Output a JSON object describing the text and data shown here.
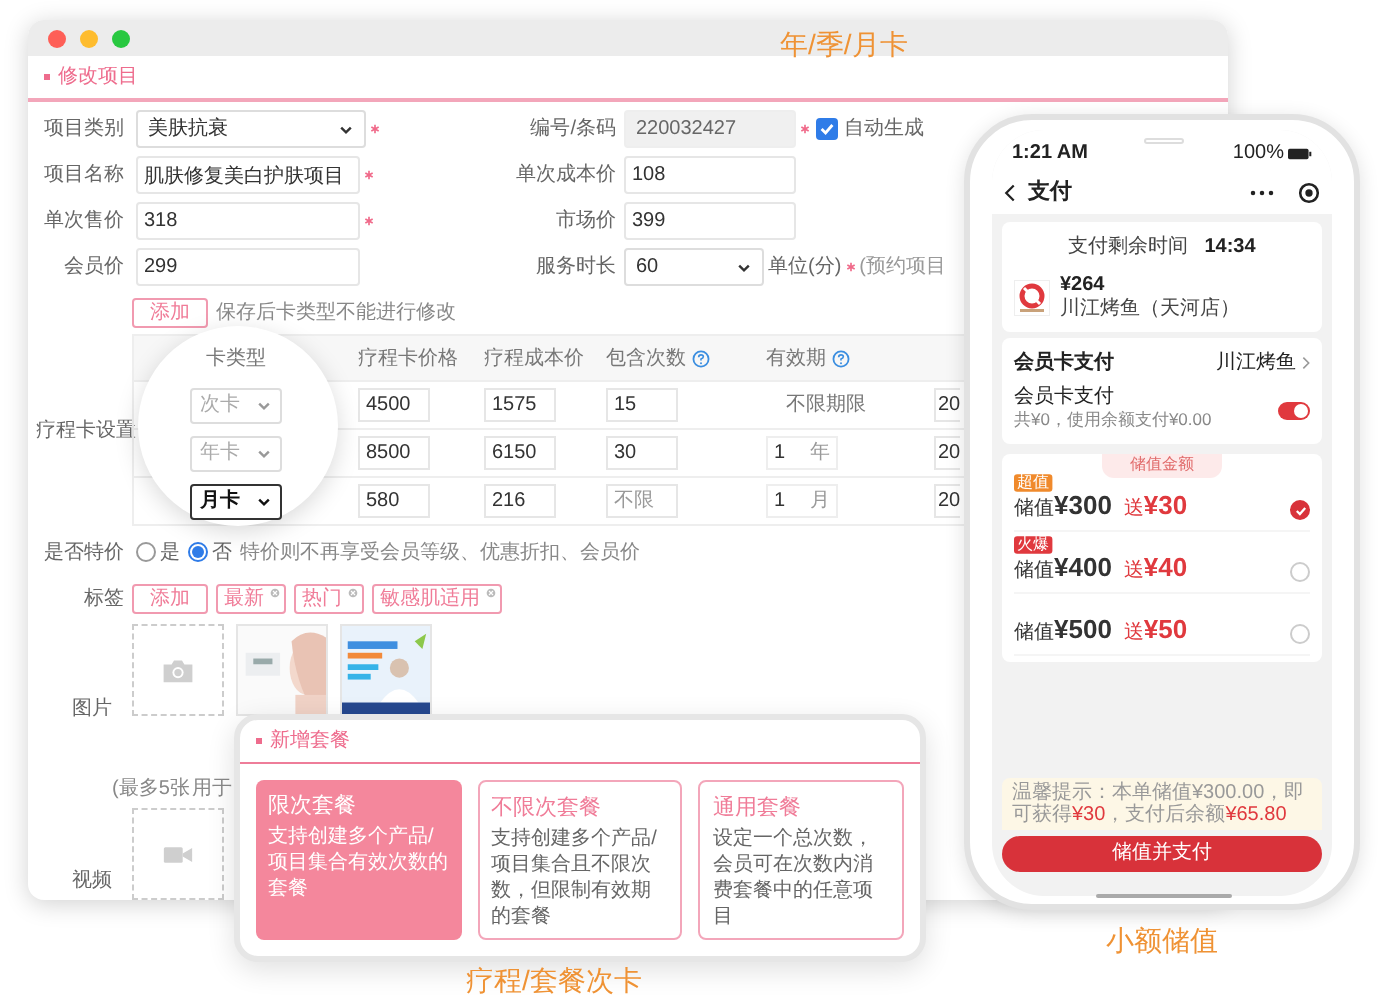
{
  "captions": [
    {
      "text": "年/季/月卡"
    },
    {
      "text": "疗程/套餐次卡"
    },
    {
      "text": "小额储值"
    }
  ],
  "editor": {
    "title": "修改项目",
    "rows": [
      {
        "left": {
          "label": "项目类别",
          "kind": "select",
          "value": "美肤抗衰",
          "required": true
        },
        "right": {
          "label": "编号/条码",
          "kind": "readonly",
          "value": "220032427",
          "required": true,
          "checkbox": {
            "label": "自动生成",
            "checked": true
          }
        }
      },
      {
        "left": {
          "label": "项目名称",
          "kind": "input",
          "value": "肌肤修复美白护肤项目",
          "required": true
        },
        "right": {
          "label": "单次成本价",
          "kind": "input",
          "value": "108",
          "required": false
        }
      },
      {
        "left": {
          "label": "单次售价",
          "kind": "input",
          "value": "318",
          "required": true
        },
        "right": {
          "label": "市场价",
          "kind": "input",
          "value": "399",
          "required": false
        }
      },
      {
        "left": {
          "label": "会员价",
          "kind": "input",
          "value": "299",
          "required": false
        },
        "right": {
          "label": "服务时长",
          "kind": "select",
          "value": "60",
          "required": true,
          "suffix": "单位(分)",
          "note": "(预约项目"
        }
      }
    ],
    "card_settings": {
      "label": "疗程卡设置",
      "add_button": "添加",
      "hint": "保存后卡类型不能进行修改",
      "columns": [
        {
          "title": "卡类型",
          "help": false
        },
        {
          "title": "疗程卡价格",
          "help": false
        },
        {
          "title": "疗程成本价",
          "help": false
        },
        {
          "title": "包含次数",
          "help": true
        },
        {
          "title": "有效期",
          "help": true
        }
      ],
      "rows": [
        {
          "card_type": "次卡",
          "disabled": true,
          "price": "4500",
          "cost": "1575",
          "count": {
            "value": "15"
          },
          "validity": {
            "kind": "unlimited",
            "text": "不限期限"
          },
          "column_6": "20"
        },
        {
          "card_type": "年卡",
          "disabled": true,
          "price": "8500",
          "cost": "6150",
          "count": {
            "value": "30"
          },
          "validity": {
            "kind": "period",
            "number": "1",
            "unit": "年"
          },
          "column_6": "20"
        },
        {
          "card_type": "月卡",
          "disabled": false,
          "price": "580",
          "cost": "216",
          "count": {
            "placeholder": "不限"
          },
          "validity": {
            "kind": "period",
            "number": "1",
            "unit": "月"
          },
          "column_6": "20"
        }
      ]
    },
    "special_price": {
      "label": "是否特价",
      "options": [
        {
          "label": "是",
          "selected": false
        },
        {
          "label": "否",
          "selected": true
        }
      ],
      "note": "特价则不再享受会员等级、优惠折扣、会员价"
    },
    "tags": {
      "label": "标签",
      "add_button": "添加",
      "items": [
        "最新",
        "热门",
        "敏感肌适用"
      ]
    },
    "images": {
      "label": "图片",
      "items": [
        {
          "kind": "upload"
        },
        {
          "kind": "picture"
        },
        {
          "kind": "picture"
        }
      ],
      "hint": [
        "(最多5张",
        "用于"
      ]
    },
    "video": {
      "label": "视频"
    }
  },
  "package_dialog": {
    "title": "新增套餐",
    "options": [
      {
        "title": "限次套餐",
        "description": "支持创建多个产品/项目集合有效次数的套餐",
        "selected": true
      },
      {
        "title": "不限次套餐",
        "description": "支持创建多个产品/项目集合且不限次数，但限制有效期的套餐",
        "selected": false
      },
      {
        "title": "通用套餐",
        "description": "设定一个总次数，会员可在次数内消费套餐中的任意项目",
        "selected": false
      }
    ]
  },
  "phone": {
    "time": "1:21 AM",
    "battery": "100%",
    "title": "支付",
    "countdown_label": "支付剩余时间",
    "countdown": "14:34",
    "order": {
      "amount": "¥264",
      "merchant": "川江烤鱼（天河店）"
    },
    "member_card": {
      "title": "会员卡支付",
      "store": "川江烤鱼",
      "option": "会员卡支付",
      "detail": "共¥0，使用余额支付¥0.00",
      "on": true
    },
    "recharge": {
      "title": "储值金额",
      "options": [
        {
          "badge": "超值",
          "color": "#f08a2c",
          "label": "储值",
          "amount": "¥300",
          "bonus_label": "送",
          "bonus": "¥30",
          "selected": true
        },
        {
          "badge": "火爆",
          "color": "#e0393e",
          "label": "储值",
          "amount": "¥400",
          "bonus_label": "送",
          "bonus": "¥40",
          "selected": false
        },
        {
          "label": "储值",
          "amount": "¥500",
          "bonus_label": "送",
          "bonus": "¥50",
          "selected": false
        }
      ]
    },
    "notice": [
      {
        "text": "温馨提示：本单储值¥300.00，即可获得",
        "highlight": false
      },
      {
        "text": "¥30",
        "highlight": true
      },
      {
        "text": "，支付后余额",
        "highlight": false
      },
      {
        "text": "¥65.80",
        "highlight": true
      }
    ],
    "button": "储值并支付"
  }
}
